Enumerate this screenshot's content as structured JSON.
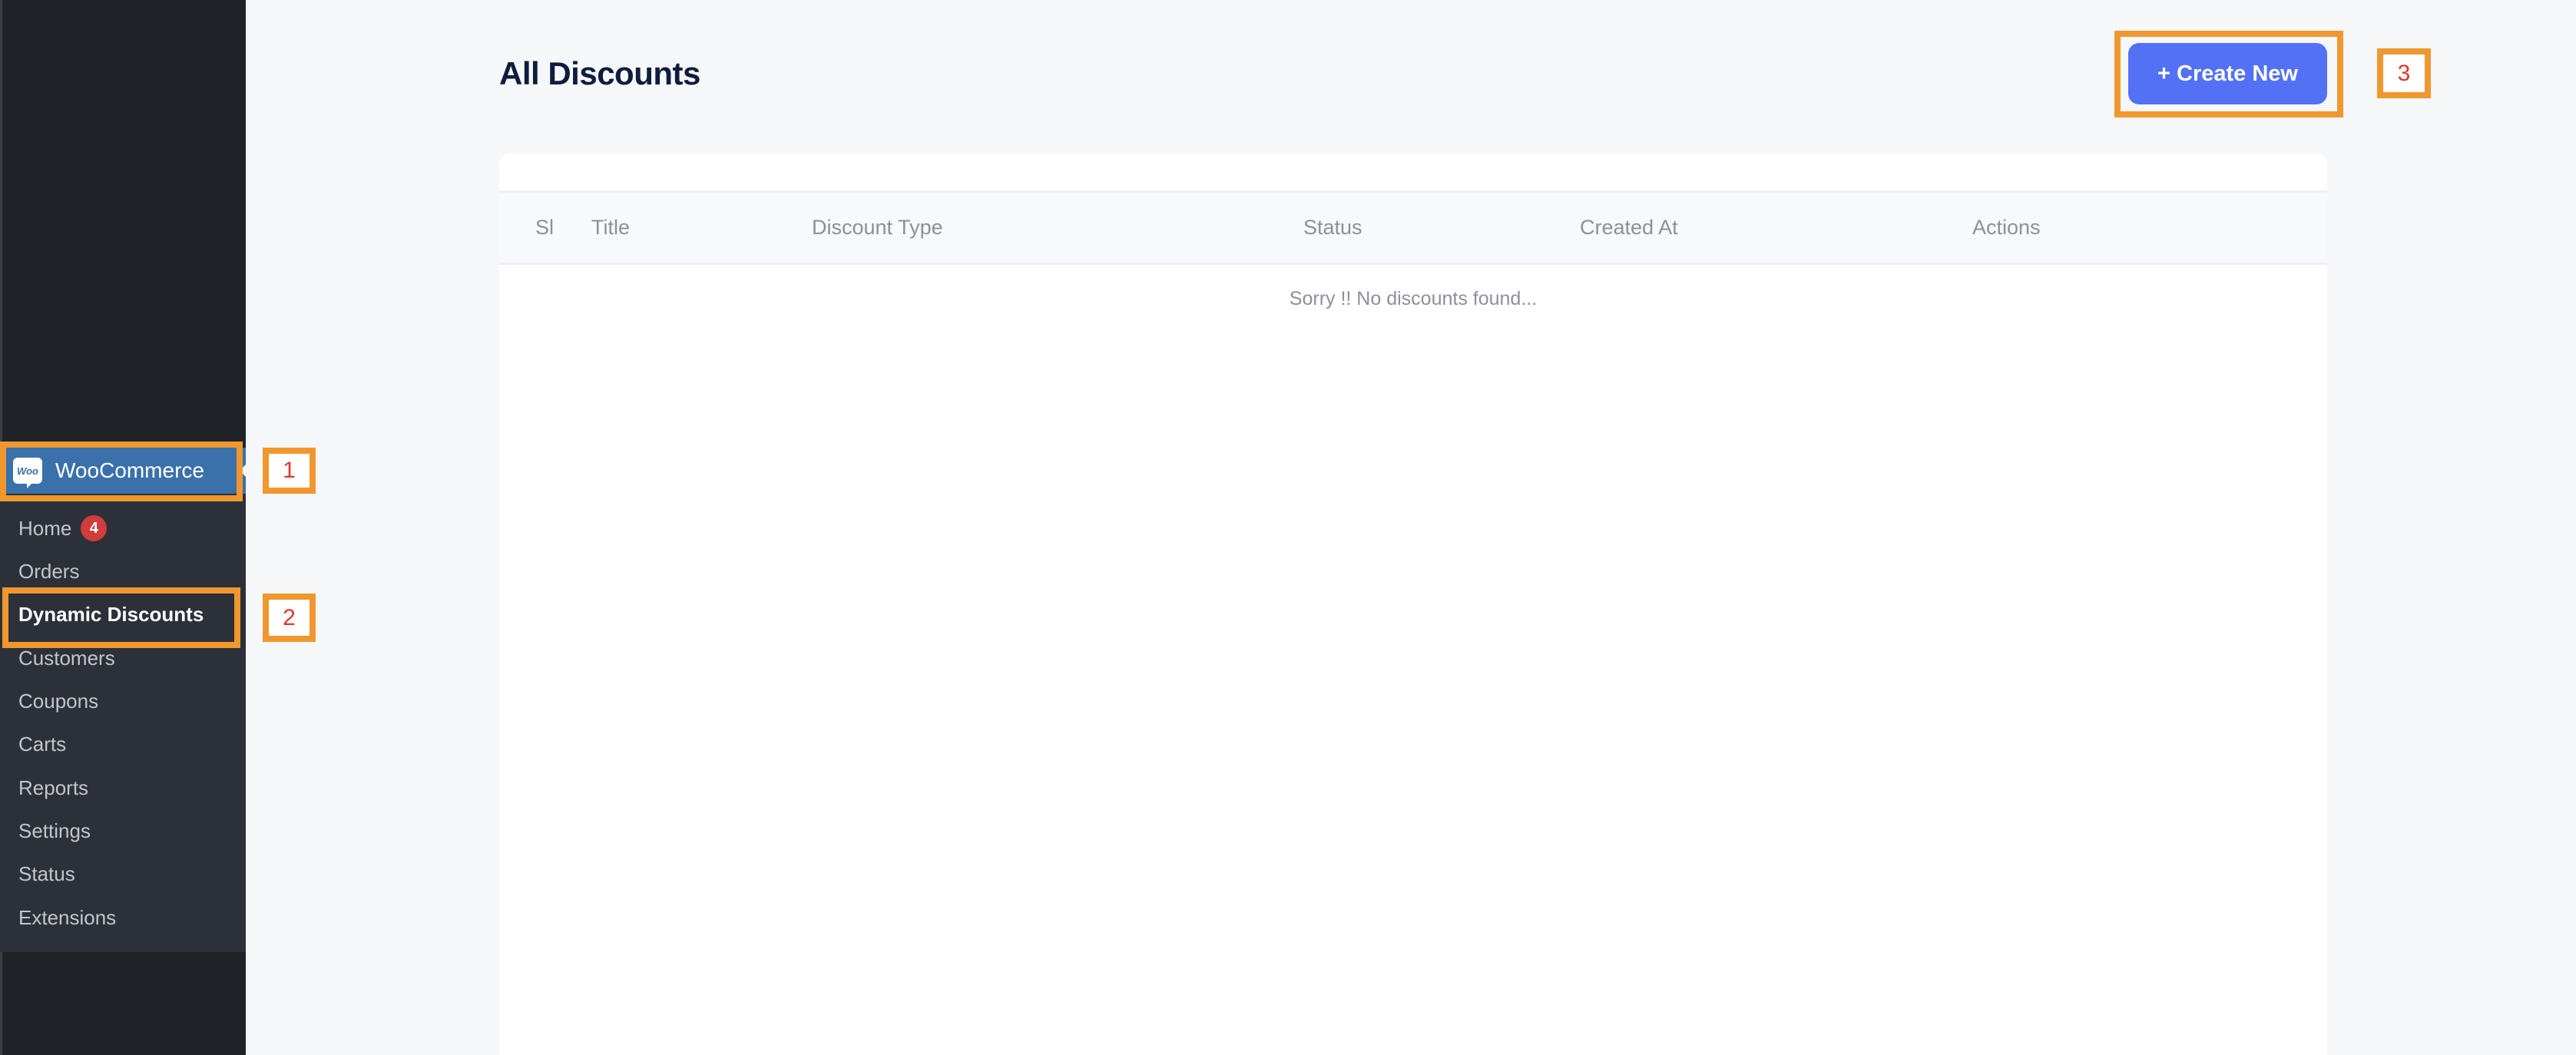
{
  "sidebar": {
    "menu_parent": {
      "label": "WooCommerce",
      "icon": "woo-logo-icon",
      "logo_text": "Woo",
      "color": "#3a71ab"
    },
    "submenu": [
      {
        "label": "Home",
        "badge": "4"
      },
      {
        "label": "Orders"
      },
      {
        "label": "Dynamic Discounts",
        "active": true
      },
      {
        "label": "Customers"
      },
      {
        "label": "Coupons"
      },
      {
        "label": "Carts"
      },
      {
        "label": "Reports"
      },
      {
        "label": "Settings"
      },
      {
        "label": "Status"
      },
      {
        "label": "Extensions"
      }
    ]
  },
  "annotations": [
    {
      "label": "1",
      "target": "WooCommerce"
    },
    {
      "label": "2",
      "target": "Dynamic Discounts"
    },
    {
      "label": "3",
      "target": "+ Create New"
    }
  ],
  "header": {
    "title": "All Discounts",
    "create_button_label": "+ Create New",
    "accent_color": "#5271f5"
  },
  "table": {
    "columns": [
      "Sl",
      "Title",
      "Discount Type",
      "Status",
      "Created At",
      "Actions"
    ],
    "rows": [],
    "empty_message": "Sorry !! No discounts found..."
  }
}
